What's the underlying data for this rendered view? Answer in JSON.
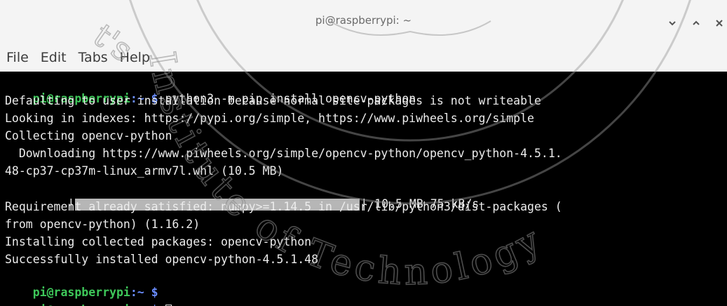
{
  "window": {
    "title": "pi@raspberrypi: ~"
  },
  "icons": {
    "minimize": "chevron-down-icon",
    "maximize": "chevron-up-icon",
    "close": "close-icon"
  },
  "menu": [
    "File",
    "Edit",
    "Tabs",
    "Help"
  ],
  "prompt": {
    "user": "pi@raspberrypi",
    "path": ":~",
    "symbol": " $ "
  },
  "colors": {
    "prompt_user": "#3ec85a",
    "prompt_path": "#6a8dff",
    "terminal_bg": "#000000",
    "terminal_text": "#ececec"
  },
  "terminal": {
    "command": "python3 -m pip install opencv-python",
    "lines": [
      "Defaulting to user installation because normal site-packages is not writeable",
      "Looking in indexes: https://pypi.org/simple, https://www.piwheels.org/simple",
      "Collecting opencv-python",
      "  Downloading https://www.piwheels.org/simple/opencv-python/opencv_python-4.5.1.",
      "48-cp37-cp37m-linux_armv7l.whl (10.5 MB)"
    ],
    "progress": {
      "indent": "     |",
      "end": "| 10.5 MB 75 kB/s",
      "fraction": 1.0
    },
    "lines_after": [
      "Requirement already satisfied: numpy>=1.14.5 in /usr/lib/python3/dist-packages (",
      "from opencv-python) (1.16.2)",
      "Installing collected packages: opencv-python",
      "Successfully installed opencv-python-4.5.1.48"
    ]
  },
  "watermark": {
    "arc_text": "Institute of Technology",
    "fragment": "t's"
  }
}
